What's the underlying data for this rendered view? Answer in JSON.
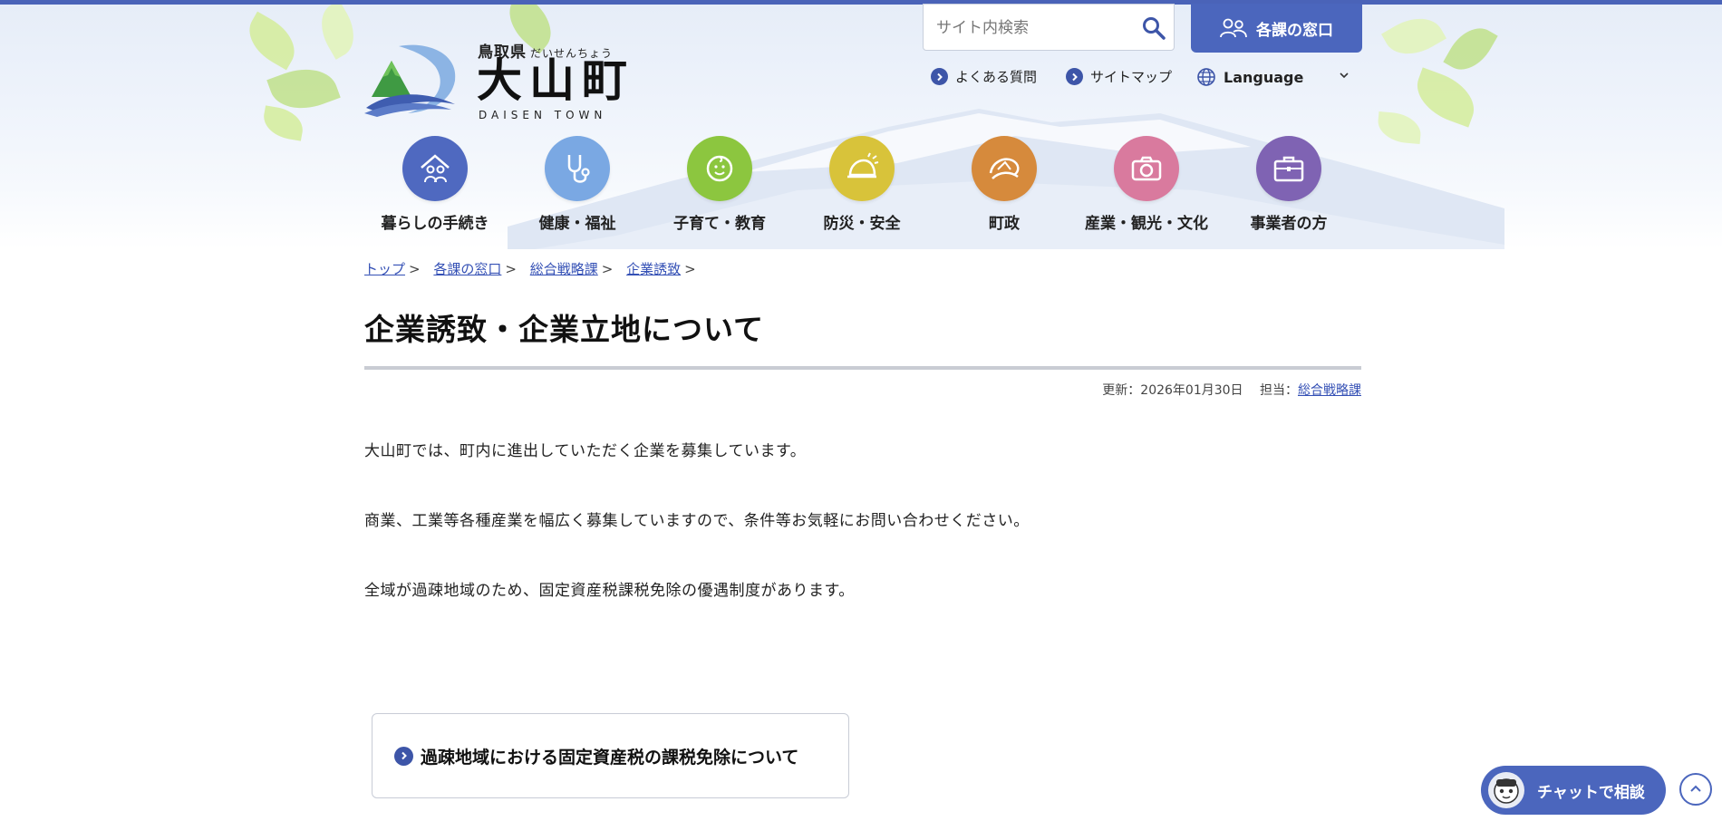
{
  "logo": {
    "prefecture": "鳥取県",
    "reading": "だいせんちょう",
    "name": "大山町",
    "english": "DAISEN TOWN"
  },
  "header": {
    "search_placeholder": "サイト内検索",
    "window_button": "各課の窓口",
    "faq": "よくある質問",
    "sitemap": "サイトマップ",
    "language": "Language"
  },
  "nav": {
    "items": [
      {
        "label": "暮らしの手続き",
        "icon": "house-family-icon",
        "color": "#4f69c0"
      },
      {
        "label": "健康・福祉",
        "icon": "stethoscope-icon",
        "color": "#7aa8e3"
      },
      {
        "label": "子育て・教育",
        "icon": "baby-icon",
        "color": "#8cc63f"
      },
      {
        "label": "防災・安全",
        "icon": "helmet-icon",
        "color": "#d8c33a"
      },
      {
        "label": "町政",
        "icon": "mountain-seal-icon",
        "color": "#d68a3c"
      },
      {
        "label": "産業・観光・文化",
        "icon": "camera-icon",
        "color": "#d97a9e"
      },
      {
        "label": "事業者の方",
        "icon": "briefcase-icon",
        "color": "#7f63b3"
      }
    ]
  },
  "breadcrumb": {
    "items": [
      "トップ",
      "各課の窓口",
      "総合戦略課",
      "企業誘致"
    ]
  },
  "page": {
    "title": "企業誘致・企業立地について",
    "updated_label": "更新：2026年01月30日",
    "owner_label": "担当：",
    "owner_link": "総合戦略課",
    "paragraphs": [
      "大山町では、町内に進出していただく企業を募集しています。",
      "商業、工業等各種産業を幅広く募集していますので、条件等お気軽にお問い合わせください。",
      "全域が過疎地域のため、固定資産税課税免除の優遇制度があります。"
    ],
    "link_box": "過疎地域における固定資産税の課税免除について"
  },
  "chat": {
    "label": "チャットで相談"
  },
  "colors": {
    "accent": "#4b66bd",
    "link": "#3450b5"
  }
}
